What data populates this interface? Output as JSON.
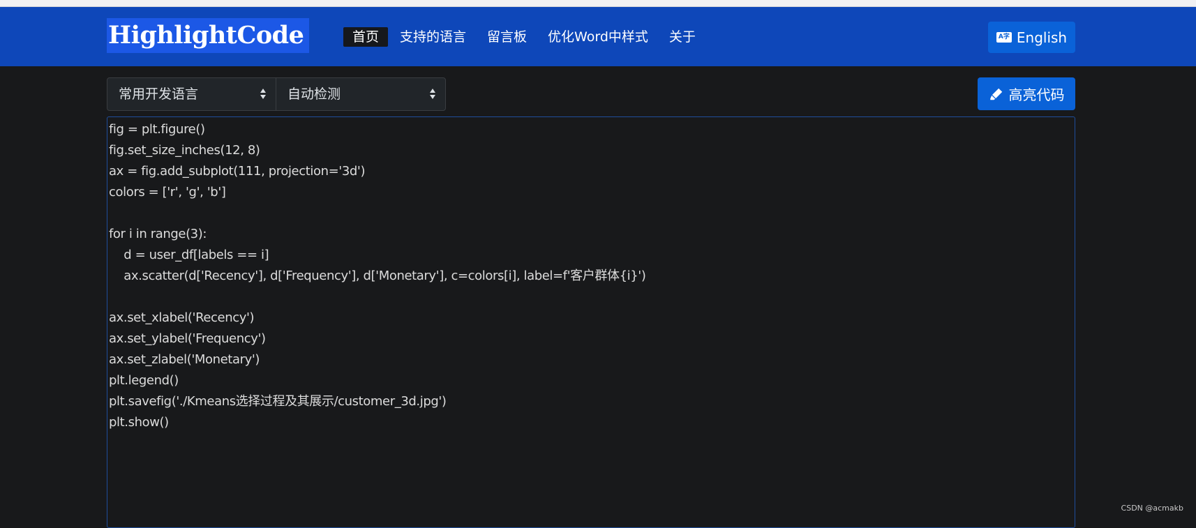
{
  "brand": "HighlightCode",
  "nav": [
    "首页",
    "支持的语言",
    "留言板",
    "优化Word中样式",
    "关于"
  ],
  "language_button": {
    "icon": "A字",
    "label": "English"
  },
  "selects": {
    "category": "常用开发语言",
    "language": "自动检测"
  },
  "highlight_button": "高亮代码",
  "code_lines": [
    "fig = plt.figure()",
    "fig.set_size_inches(12, 8)",
    "ax = fig.add_subplot(111, projection='3d')",
    "colors = ['r', 'g', 'b']",
    "",
    "for i in range(3):",
    "    d = user_df[labels == i]",
    "    ax.scatter(d['Recency'], d['Frequency'], d['Monetary'], c=colors[i], label=f'客户群体{i}')",
    "",
    "ax.set_xlabel('Recency')",
    "ax.set_ylabel('Frequency')",
    "ax.set_zlabel('Monetary')",
    "plt.legend()",
    "plt.savefig('./Kmeans选择过程及其展示/customer_3d.jpg')",
    "plt.show()"
  ],
  "watermark": "CSDN @acmakb",
  "colors": {
    "navbar": "#0e47b9",
    "button": "#0a62d8",
    "background": "#18191b"
  },
  "icons": {
    "language": "translate-icon",
    "highlight": "highlighter-pen-icon",
    "select": "select-caret-icon"
  }
}
